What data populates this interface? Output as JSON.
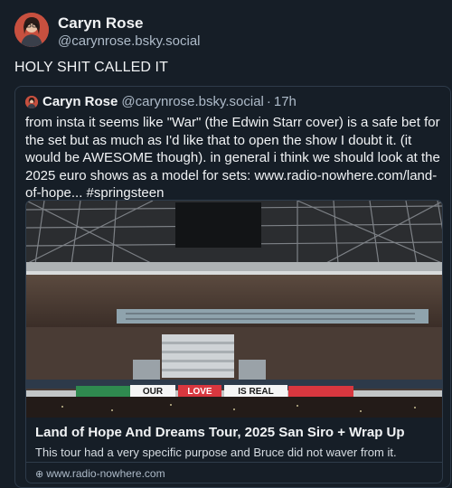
{
  "post": {
    "author_name": "Caryn Rose",
    "author_handle": "@carynrose.bsky.social",
    "text": "HOLY SHIT CALLED IT"
  },
  "quote": {
    "author_name": "Caryn Rose",
    "author_handle": "@carynrose.bsky.social",
    "separator": "·",
    "time": "17h",
    "text": "from insta it seems like \"War\" (the Edwin Starr cover) is a safe bet for the set but as much as I'd like that to open the show I doubt it. (it would be AWESOME though). in general i think we should look at the 2025 euro shows as a model for sets: www.radio-nowhere.com/land-of-hope... #springsteen"
  },
  "link_card": {
    "image_banner": [
      "OUR",
      "LOVE",
      "IS REAL"
    ],
    "title": "Land of Hope And Dreams Tour, 2025 San Siro + Wrap Up",
    "description": "This tour had a very specific purpose and Bruce did not waver from it.",
    "domain": "www.radio-nowhere.com"
  },
  "colors": {
    "background": "#161e27",
    "text": "#f1f3f5",
    "muted": "#aebbc9",
    "border": "#2e3b4a"
  },
  "icons": {
    "avatar": "avatar",
    "domain": "globe-icon"
  }
}
